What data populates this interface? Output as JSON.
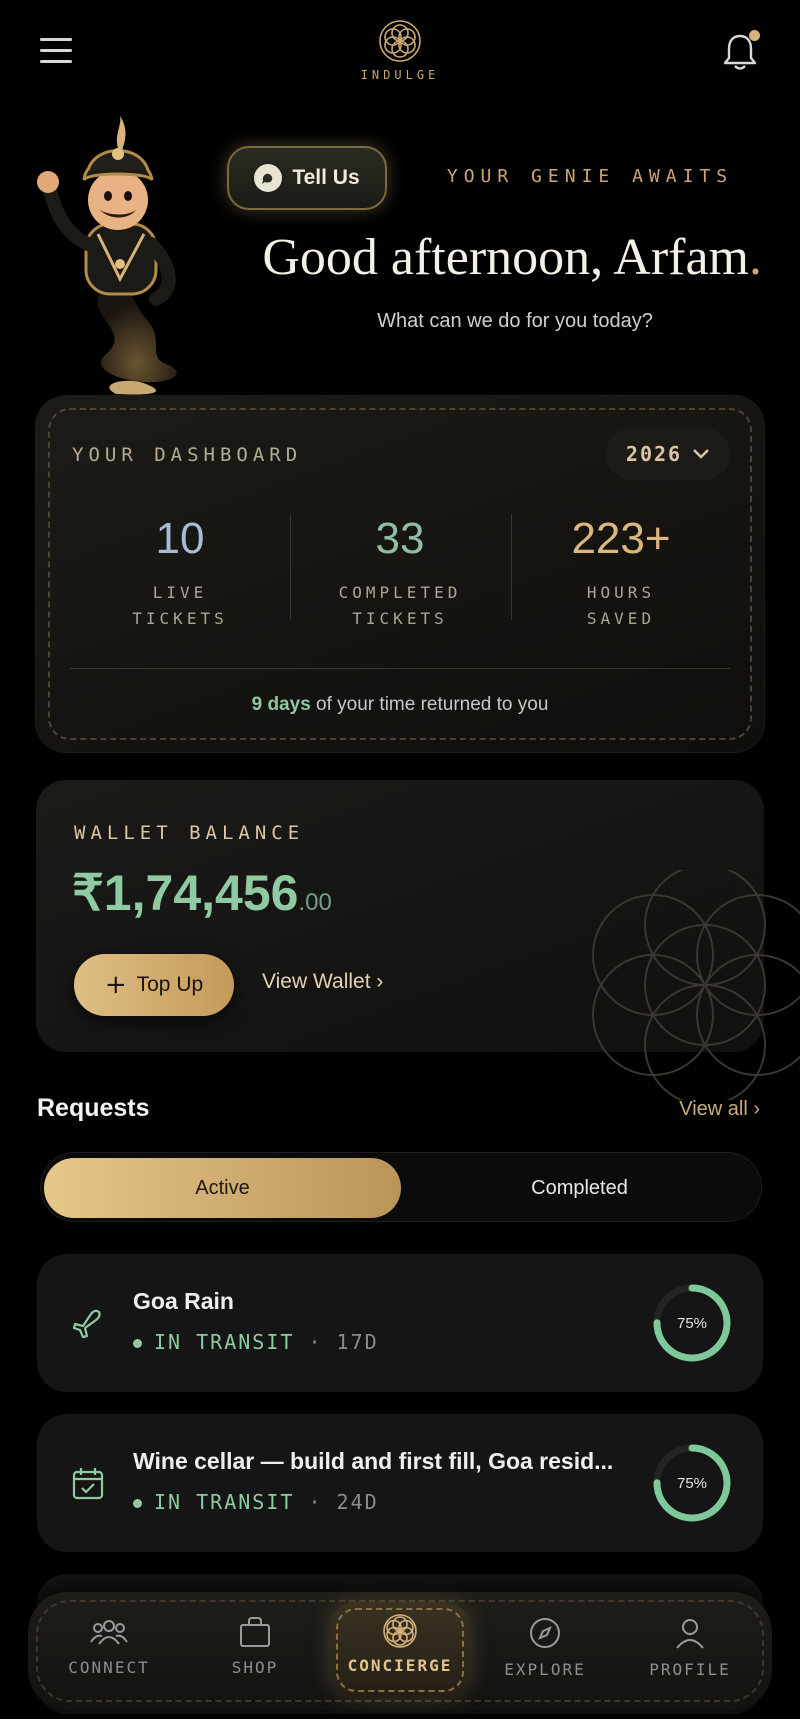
{
  "header": {
    "brand": "INDULGE",
    "menu_icon": "hamburger-icon",
    "notification_icon": "bell-icon"
  },
  "hero": {
    "tell_us_label": "Tell Us",
    "tell_us_icon": "whatsapp-icon",
    "tagline": "YOUR GENIE AWAITS",
    "greeting": "Good afternoon, Arfam",
    "greeting_punct": ".",
    "subtitle": "What can we do for you today?"
  },
  "dashboard": {
    "title": "YOUR DASHBOARD",
    "year": "2026",
    "stats": [
      {
        "value": "10",
        "line1": "LIVE",
        "line2": "TICKETS",
        "color": "#a9bbd6"
      },
      {
        "value": "33",
        "line1": "COMPLETED",
        "line2": "TICKETS",
        "color": "#8fbfa0"
      },
      {
        "value": "223+",
        "line1": "HOURS",
        "line2": "SAVED",
        "color": "#dcb77c"
      }
    ],
    "returned_highlight": "9 days",
    "returned_rest": " of your time returned to you"
  },
  "wallet": {
    "title": "WALLET BALANCE",
    "amount": "₹1,74,456",
    "decimals": ".00",
    "topup_label": "Top Up",
    "view_wallet_label": "View Wallet ›"
  },
  "requests": {
    "title": "Requests",
    "view_all": "View all ›",
    "tabs": {
      "active": "Active",
      "completed": "Completed"
    },
    "items": [
      {
        "name": "Goa Rain",
        "status": "IN TRANSIT",
        "days": "· 17D",
        "progress_label": "75%",
        "progress": 0.75,
        "icon": "airplane-icon"
      },
      {
        "name": "Wine cellar — build and first fill, Goa resid...",
        "status": "IN TRANSIT",
        "days": "· 24D",
        "progress_label": "75%",
        "progress": 0.75,
        "icon": "calendar-check-icon"
      }
    ]
  },
  "nav": {
    "items": [
      {
        "label": "CONNECT",
        "icon": "people-icon"
      },
      {
        "label": "SHOP",
        "icon": "shopping-bag-icon"
      },
      {
        "label": "CONCIERGE",
        "icon": "flower-of-life-icon"
      },
      {
        "label": "EXPLORE",
        "icon": "compass-icon"
      },
      {
        "label": "PROFILE",
        "icon": "user-icon"
      }
    ]
  },
  "colors": {
    "gold": "#c9a773",
    "green": "#8fcaa3",
    "background": "#000000"
  }
}
